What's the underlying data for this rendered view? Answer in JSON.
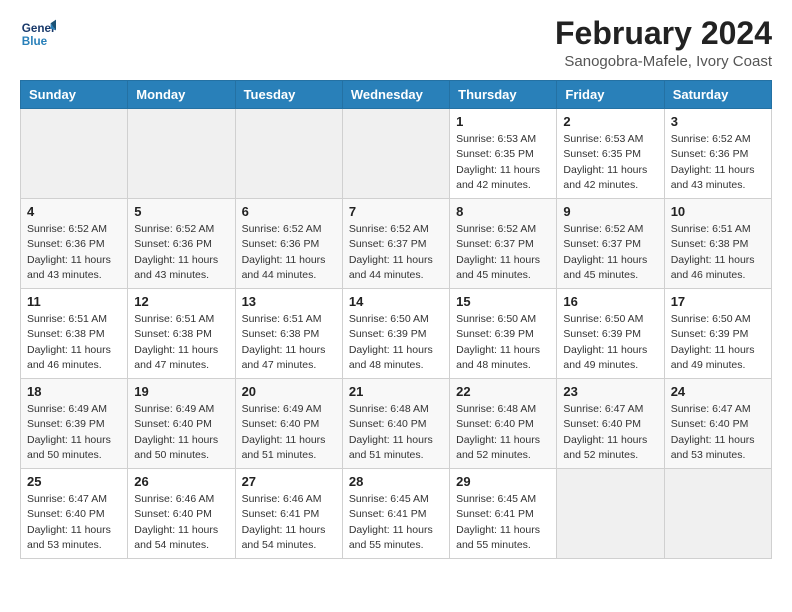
{
  "logo": {
    "line1": "General",
    "line2": "Blue"
  },
  "title": "February 2024",
  "location": "Sanogobra-Mafele, Ivory Coast",
  "headers": [
    "Sunday",
    "Monday",
    "Tuesday",
    "Wednesday",
    "Thursday",
    "Friday",
    "Saturday"
  ],
  "weeks": [
    [
      {
        "day": "",
        "info": ""
      },
      {
        "day": "",
        "info": ""
      },
      {
        "day": "",
        "info": ""
      },
      {
        "day": "",
        "info": ""
      },
      {
        "day": "1",
        "info": "Sunrise: 6:53 AM\nSunset: 6:35 PM\nDaylight: 11 hours\nand 42 minutes."
      },
      {
        "day": "2",
        "info": "Sunrise: 6:53 AM\nSunset: 6:35 PM\nDaylight: 11 hours\nand 42 minutes."
      },
      {
        "day": "3",
        "info": "Sunrise: 6:52 AM\nSunset: 6:36 PM\nDaylight: 11 hours\nand 43 minutes."
      }
    ],
    [
      {
        "day": "4",
        "info": "Sunrise: 6:52 AM\nSunset: 6:36 PM\nDaylight: 11 hours\nand 43 minutes."
      },
      {
        "day": "5",
        "info": "Sunrise: 6:52 AM\nSunset: 6:36 PM\nDaylight: 11 hours\nand 43 minutes."
      },
      {
        "day": "6",
        "info": "Sunrise: 6:52 AM\nSunset: 6:36 PM\nDaylight: 11 hours\nand 44 minutes."
      },
      {
        "day": "7",
        "info": "Sunrise: 6:52 AM\nSunset: 6:37 PM\nDaylight: 11 hours\nand 44 minutes."
      },
      {
        "day": "8",
        "info": "Sunrise: 6:52 AM\nSunset: 6:37 PM\nDaylight: 11 hours\nand 45 minutes."
      },
      {
        "day": "9",
        "info": "Sunrise: 6:52 AM\nSunset: 6:37 PM\nDaylight: 11 hours\nand 45 minutes."
      },
      {
        "day": "10",
        "info": "Sunrise: 6:51 AM\nSunset: 6:38 PM\nDaylight: 11 hours\nand 46 minutes."
      }
    ],
    [
      {
        "day": "11",
        "info": "Sunrise: 6:51 AM\nSunset: 6:38 PM\nDaylight: 11 hours\nand 46 minutes."
      },
      {
        "day": "12",
        "info": "Sunrise: 6:51 AM\nSunset: 6:38 PM\nDaylight: 11 hours\nand 47 minutes."
      },
      {
        "day": "13",
        "info": "Sunrise: 6:51 AM\nSunset: 6:38 PM\nDaylight: 11 hours\nand 47 minutes."
      },
      {
        "day": "14",
        "info": "Sunrise: 6:50 AM\nSunset: 6:39 PM\nDaylight: 11 hours\nand 48 minutes."
      },
      {
        "day": "15",
        "info": "Sunrise: 6:50 AM\nSunset: 6:39 PM\nDaylight: 11 hours\nand 48 minutes."
      },
      {
        "day": "16",
        "info": "Sunrise: 6:50 AM\nSunset: 6:39 PM\nDaylight: 11 hours\nand 49 minutes."
      },
      {
        "day": "17",
        "info": "Sunrise: 6:50 AM\nSunset: 6:39 PM\nDaylight: 11 hours\nand 49 minutes."
      }
    ],
    [
      {
        "day": "18",
        "info": "Sunrise: 6:49 AM\nSunset: 6:39 PM\nDaylight: 11 hours\nand 50 minutes."
      },
      {
        "day": "19",
        "info": "Sunrise: 6:49 AM\nSunset: 6:40 PM\nDaylight: 11 hours\nand 50 minutes."
      },
      {
        "day": "20",
        "info": "Sunrise: 6:49 AM\nSunset: 6:40 PM\nDaylight: 11 hours\nand 51 minutes."
      },
      {
        "day": "21",
        "info": "Sunrise: 6:48 AM\nSunset: 6:40 PM\nDaylight: 11 hours\nand 51 minutes."
      },
      {
        "day": "22",
        "info": "Sunrise: 6:48 AM\nSunset: 6:40 PM\nDaylight: 11 hours\nand 52 minutes."
      },
      {
        "day": "23",
        "info": "Sunrise: 6:47 AM\nSunset: 6:40 PM\nDaylight: 11 hours\nand 52 minutes."
      },
      {
        "day": "24",
        "info": "Sunrise: 6:47 AM\nSunset: 6:40 PM\nDaylight: 11 hours\nand 53 minutes."
      }
    ],
    [
      {
        "day": "25",
        "info": "Sunrise: 6:47 AM\nSunset: 6:40 PM\nDaylight: 11 hours\nand 53 minutes."
      },
      {
        "day": "26",
        "info": "Sunrise: 6:46 AM\nSunset: 6:40 PM\nDaylight: 11 hours\nand 54 minutes."
      },
      {
        "day": "27",
        "info": "Sunrise: 6:46 AM\nSunset: 6:41 PM\nDaylight: 11 hours\nand 54 minutes."
      },
      {
        "day": "28",
        "info": "Sunrise: 6:45 AM\nSunset: 6:41 PM\nDaylight: 11 hours\nand 55 minutes."
      },
      {
        "day": "29",
        "info": "Sunrise: 6:45 AM\nSunset: 6:41 PM\nDaylight: 11 hours\nand 55 minutes."
      },
      {
        "day": "",
        "info": ""
      },
      {
        "day": "",
        "info": ""
      }
    ]
  ]
}
